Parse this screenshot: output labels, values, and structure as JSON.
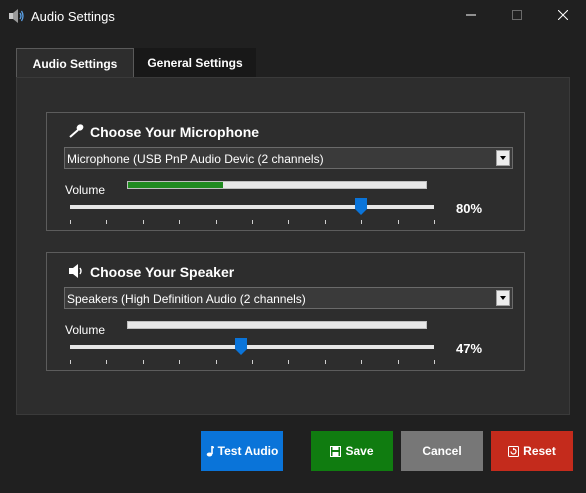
{
  "window": {
    "title": "Audio Settings",
    "icon": "speaker-icon",
    "controls": [
      "minimize-icon",
      "maximize-icon",
      "close-icon"
    ]
  },
  "tabs": [
    {
      "label": "Audio Settings",
      "active": true
    },
    {
      "label": "General Settings",
      "active": false
    }
  ],
  "microphone": {
    "title": "Choose Your Microphone",
    "icon": "microphone-icon",
    "device": "Microphone (USB PnP Audio Devic (2 channels)",
    "volume_label": "Volume",
    "input_level": 0.32,
    "volume_percent": 80,
    "volume_text": "80%"
  },
  "speaker": {
    "title": "Choose Your Speaker",
    "icon": "speaker-icon",
    "device": "Speakers (High Definition Audio (2 channels)",
    "volume_label": "Volume",
    "volume_percent": 47,
    "volume_text": "47%"
  },
  "buttons": {
    "test": {
      "label": "Test Audio",
      "icon": "music-note-icon",
      "color": "#0a74d9"
    },
    "save": {
      "label": "Save",
      "icon": "floppy-disk-icon",
      "color": "#107c10"
    },
    "cancel": {
      "label": "Cancel",
      "color": "#777777"
    },
    "reset": {
      "label": "Reset",
      "icon": "reset-icon",
      "color": "#c42b1c"
    }
  },
  "colors": {
    "accent": "#0a74d9",
    "level_fill": "#1f8a1f",
    "background": "#202020",
    "panel": "#2d2d2d"
  }
}
